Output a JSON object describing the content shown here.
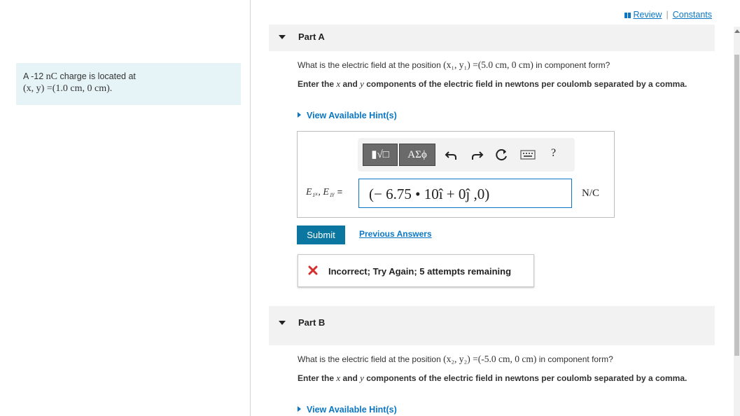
{
  "top_links": {
    "review": "Review",
    "separator": "|",
    "constants": "Constants"
  },
  "info": {
    "prefix": "A -12 ",
    "unit": "nC",
    "suffix": " charge is located at",
    "position_math": "(x, y) =(1.0 cm, 0 cm)."
  },
  "part_a": {
    "label": "Part A",
    "question_pre": "What is the electric field at the position ",
    "question_math": "(x₁, y₁) =(5.0 cm, 0 cm)",
    "question_post": " in component form?",
    "instruction_pre": "Enter the ",
    "instruction_x": "x",
    "instruction_mid": " and ",
    "instruction_y": "y",
    "instruction_post": " components of the electric field in newtons per coulomb separated by a comma.",
    "hint": "View Available Hint(s)",
    "toolbar": {
      "templates_label": "▮√□",
      "greek_label": "ΑΣϕ",
      "help_label": "?"
    },
    "expr_label_math": "E₁ₓ, E₁ᵧ",
    "expr_label_eq": " =",
    "answer_value": "(− 6.75 • 10î + 0ĵ ,0)",
    "unit": "N/C",
    "submit": "Submit",
    "previous_answers": "Previous Answers",
    "feedback": "Incorrect; Try Again; 5 attempts remaining"
  },
  "part_b": {
    "label": "Part B",
    "question_pre": "What is the electric field at the position ",
    "question_math": "(x₂, y₂) =(-5.0 cm, 0 cm)",
    "question_post": " in component form?",
    "instruction_pre": "Enter the ",
    "instruction_x": "x",
    "instruction_mid": " and ",
    "instruction_y": "y",
    "instruction_post": " components of the electric field in newtons per coulomb separated by a comma.",
    "hint": "View Available Hint(s)"
  },
  "colors": {
    "link": "#0b77c4",
    "submit_bg": "#0b77a0",
    "info_bg": "#e6f4f7",
    "error": "#d62d2d"
  }
}
